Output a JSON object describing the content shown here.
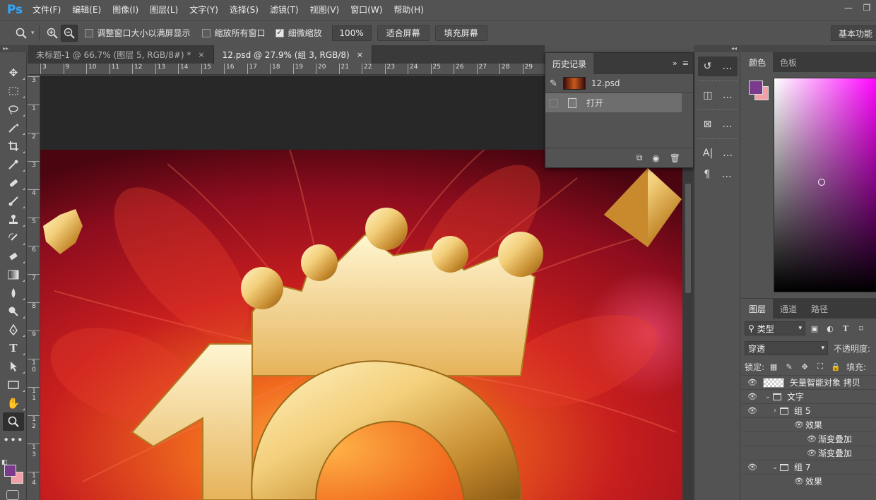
{
  "app": {
    "logo": "Ps"
  },
  "menu": [
    "文件(F)",
    "编辑(E)",
    "图像(I)",
    "图层(L)",
    "文字(Y)",
    "选择(S)",
    "滤镜(T)",
    "视图(V)",
    "窗口(W)",
    "帮助(H)"
  ],
  "options": {
    "resize_windows": "调整窗口大小以满屏显示",
    "zoom_all": "缩放所有窗口",
    "scrubby_zoom": "细微缩放",
    "zoom_value": "100%",
    "fit_screen": "适合屏幕",
    "fill_screen": "填充屏幕",
    "workspace": "基本功能"
  },
  "tabs": [
    {
      "label": "未标题-1 @ 66.7% (图层 5, RGB/8#) *",
      "close": "×"
    },
    {
      "label": "12.psd @ 27.9% (组 3, RGB/8)",
      "close": "×"
    }
  ],
  "ruler_h": [
    "3",
    "9",
    "10",
    "11",
    "12",
    "13",
    "14",
    "15",
    "16",
    "17",
    "18",
    "19",
    "20",
    "21",
    "22",
    "23",
    "24",
    "25",
    "26",
    "27",
    "28",
    "29"
  ],
  "ruler_v": [
    "3",
    "1",
    "2",
    "3",
    "4",
    "5",
    "6",
    "7",
    "8",
    "9",
    "1 0",
    "1 1",
    "1 2",
    "1 3",
    "1 4"
  ],
  "history": {
    "title": "历史记录",
    "snapshot": "12.psd",
    "items": [
      "打开"
    ]
  },
  "color_panel": {
    "tabs": [
      "颜色",
      "色板"
    ],
    "fg": "#7b3a8c",
    "bg": "#f2a0a8"
  },
  "layers_panel": {
    "tabs": [
      "图层",
      "通道",
      "路径"
    ],
    "filter": "类型",
    "blend": "穿透",
    "opacity_label": "不透明度:",
    "lock_label": "锁定:",
    "fill_label": "填充:",
    "layers": [
      "矢量智能对象 拷贝",
      "文字",
      "组 5",
      "效果",
      "渐变叠加",
      "渐变叠加",
      "组 7",
      "效果"
    ]
  },
  "colors": {
    "ui": "#535353",
    "dark": "#3a3a3a",
    "canvas_bg": "#282828",
    "accent": "#31a8ff"
  }
}
